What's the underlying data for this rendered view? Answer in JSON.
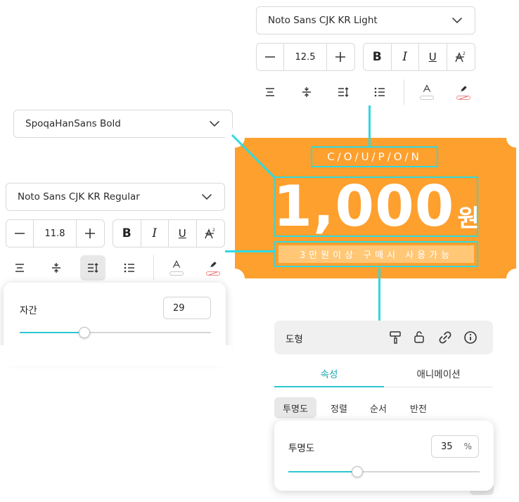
{
  "top_toolbar": {
    "font": "Noto Sans CJK KR Light",
    "size_value": "12.5",
    "style": {
      "bold": "B",
      "italic": "I",
      "underline": "U"
    }
  },
  "left_dropdown": {
    "font": "SpoqaHanSans Bold"
  },
  "left_toolbar": {
    "font": "Noto Sans CJK KR Regular",
    "size_value": "11.8",
    "style": {
      "bold": "B",
      "italic": "I",
      "underline": "U"
    }
  },
  "letter_spacing_panel": {
    "label": "자간",
    "value": "29",
    "slider_fraction": 0.34
  },
  "coupon": {
    "heading": "C/O/U/P/O/N",
    "amount": "1,000",
    "unit": "원",
    "note": "3만원이상 구매시 사용가능",
    "background_color": "#fea02e",
    "guide_color": "#2fd9e0"
  },
  "object_panel": {
    "type_label": "도형",
    "icons": [
      "paint-roller-icon",
      "unlock-icon",
      "link-icon",
      "info-icon"
    ],
    "tabs": [
      "속성",
      "애니메이션"
    ],
    "active_tab": "속성",
    "subtabs": [
      "투명도",
      "정렬",
      "순서",
      "반전"
    ],
    "active_subtab": "투명도"
  },
  "opacity_panel": {
    "label": "투명도",
    "value": "35",
    "unit": "%",
    "slider_fraction": 0.36
  }
}
